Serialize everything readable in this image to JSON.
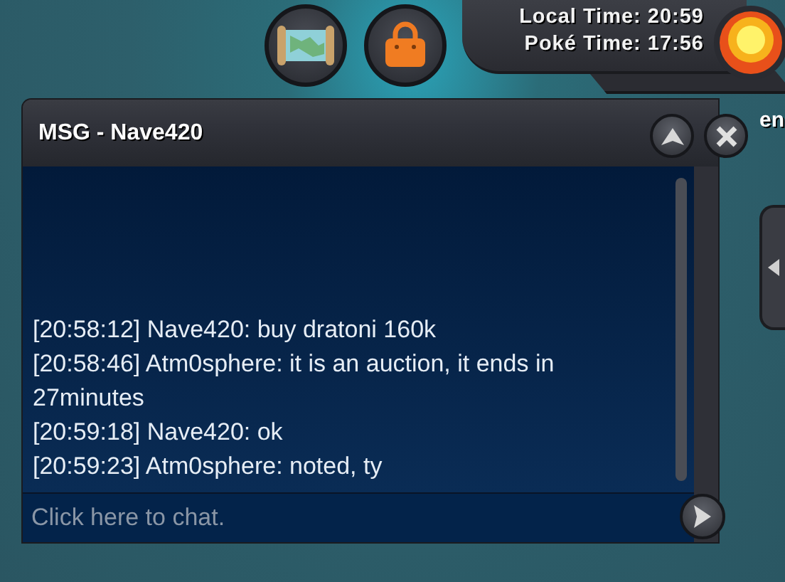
{
  "hud": {
    "local_time": "Local Time: 20:59",
    "poke_time": "Poké Time: 17:56",
    "cut_label": "en"
  },
  "chat_window": {
    "title": "MSG - Nave420",
    "messages": [
      "[20:58:12] Nave420: buy dratoni 160k",
      "[20:58:46] Atm0sphere: it is an auction, it ends in 27minutes",
      "[20:59:18] Nave420: ok",
      "[20:59:23] Atm0sphere: noted, ty"
    ],
    "input": {
      "placeholder": "Click here to chat."
    }
  }
}
